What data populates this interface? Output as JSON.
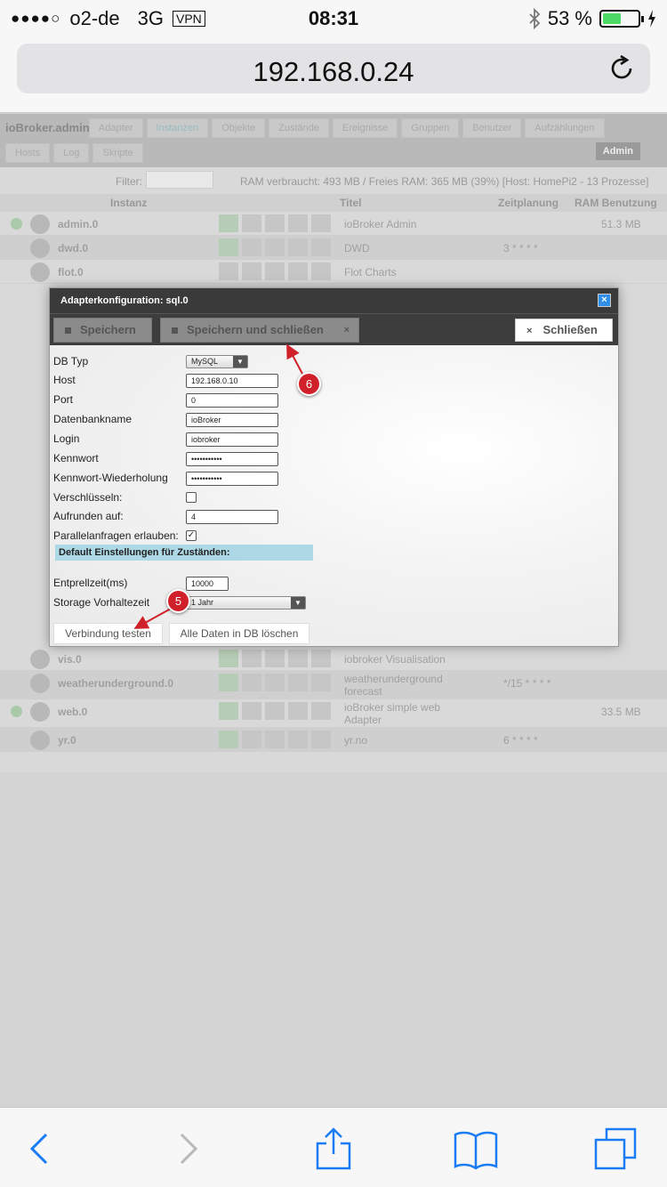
{
  "status_bar": {
    "carrier": "o2-de",
    "network": "3G",
    "vpn": "VPN",
    "time": "08:31",
    "battery_percent": "53 %",
    "battery_level": 0.53
  },
  "browser": {
    "url": "192.168.0.24"
  },
  "app": {
    "brand": "ioBroker.admin",
    "tabs": [
      "Adapter",
      "Instanzen",
      "Objekte",
      "Zustände",
      "Ereignisse",
      "Gruppen",
      "Benutzer",
      "Aufzählungen"
    ],
    "tabs2": [
      "Hosts",
      "Log",
      "Skripte"
    ],
    "user": "Admin",
    "filter_label": "Filter:",
    "ram_info": "RAM verbraucht: 493 MB / Freies RAM: 365 MB (39%) [Host: HomePi2 - 13 Prozesse]",
    "columns": {
      "instance": "Instanz",
      "title": "Titel",
      "schedule": "Zeitplanung",
      "ram": "RAM Benutzung"
    },
    "rows_top": [
      {
        "name": "admin.0",
        "title": "ioBroker Admin",
        "schedule": "",
        "ram": "51.3 MB"
      },
      {
        "name": "dwd.0",
        "title": "DWD",
        "schedule": "3 * * * *",
        "ram": ""
      },
      {
        "name": "flot.0",
        "title": "Flot Charts",
        "schedule": "",
        "ram": ""
      }
    ],
    "rows_bottom": [
      {
        "name": "vis.0",
        "title": "iobroker Visualisation",
        "schedule": "",
        "ram": ""
      },
      {
        "name": "weatherunderground.0",
        "title": "weatherunderground forecast",
        "schedule": "*/15 * * * *",
        "ram": ""
      },
      {
        "name": "web.0",
        "title": "ioBroker simple web Adapter",
        "schedule": "",
        "ram": "33.5 MB"
      },
      {
        "name": "yr.0",
        "title": "yr.no",
        "schedule": "6 * * * *",
        "ram": ""
      }
    ]
  },
  "modal": {
    "title": "Adapterkonfiguration: sql.0",
    "save": "Speichern",
    "save_close": "Speichern und schließen",
    "close": "Schließen",
    "fields": {
      "db_type": {
        "label": "DB Typ",
        "value": "MySQL"
      },
      "host": {
        "label": "Host",
        "value": "192.168.0.10"
      },
      "port": {
        "label": "Port",
        "value": "0"
      },
      "db_name": {
        "label": "Datenbankname",
        "value": "ioBroker"
      },
      "login": {
        "label": "Login",
        "value": "iobroker"
      },
      "password": {
        "label": "Kennwort",
        "value": "•••••••••••"
      },
      "password_repeat": {
        "label": "Kennwort-Wiederholung",
        "value": "•••••••••••"
      },
      "encrypt": {
        "label": "Verschlüsseln:",
        "checked": false
      },
      "round": {
        "label": "Aufrunden auf:",
        "value": "4"
      },
      "parallel": {
        "label": "Parallelanfragen erlauben:",
        "checked": true
      }
    },
    "section_title": "Default Einstellungen für Zuständen:",
    "debounce": {
      "label": "Entprellzeit(ms)",
      "value": "10000"
    },
    "retention": {
      "label": "Storage Vorhaltezeit",
      "value": "1 Jahr"
    },
    "test_connection": "Verbindung testen",
    "delete_all": "Alle Daten in DB löschen"
  },
  "annotations": {
    "badge_6": "6",
    "badge_5": "5",
    "color": "#d0202a"
  }
}
